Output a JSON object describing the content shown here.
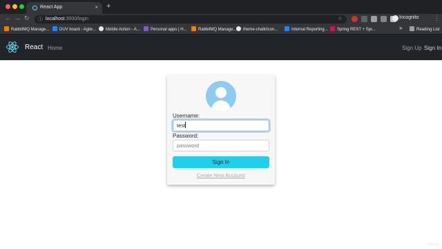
{
  "browser": {
    "tab_title": "React App",
    "tab_close": "×",
    "new_tab": "+",
    "url_host": "localhost",
    "url_path": ":3000/login",
    "profile": "Incognito",
    "menu": "⋮",
    "bookmarks": [
      {
        "label": "RabbitMQ Manage...",
        "color": "#f57c00"
      },
      {
        "label": "DUV board - Agile...",
        "color": "#2684ff"
      },
      {
        "label": "Mobile Action - A...",
        "color": "#e8eaed"
      },
      {
        "label": "Personal apps | H...",
        "color": "#7b5cc4"
      },
      {
        "label": "RabbitMQ Manage...",
        "color": "#f57c00"
      },
      {
        "label": "theme-chalk/icon...",
        "color": "#e8eaed"
      },
      {
        "label": "Internal Reporting...",
        "color": "#2684ff"
      },
      {
        "label": "Spring REST + Spr...",
        "color": "#c2185b"
      }
    ],
    "bookmarks_more": "»",
    "reading_list": "Reading List"
  },
  "app": {
    "brand": "React",
    "nav_home": "Home",
    "nav_signup": "Sign Up",
    "nav_signin": "Sign In",
    "accent": "#61dafb",
    "nav_bg": "#212529"
  },
  "login": {
    "username_label": "Username:",
    "username_value": "test",
    "password_label": "Password:",
    "password_placeholder": "password",
    "submit_label": "Sign In",
    "create_account_link": "Create New Account!",
    "button_color": "#20d0ea",
    "avatar_color": "#8ecbf1"
  },
  "watermark": "Udemy"
}
